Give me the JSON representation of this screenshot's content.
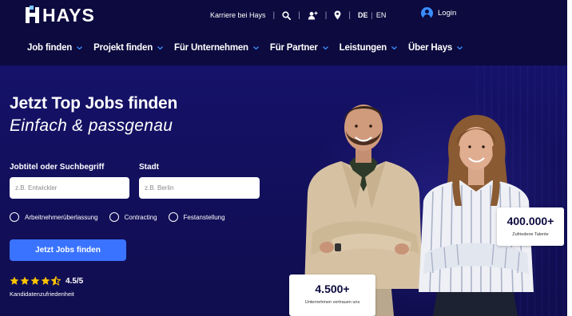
{
  "brand": {
    "logo_text": "HAYS"
  },
  "topbar": {
    "career_link": "Karriere bei Hays",
    "lang_de": "DE",
    "lang_en": "EN",
    "login_label": "Login",
    "icons": [
      "search-icon",
      "person-add-icon",
      "location-pin-icon",
      "user-icon"
    ]
  },
  "nav": {
    "items": [
      {
        "label": "Job finden"
      },
      {
        "label": "Projekt finden"
      },
      {
        "label": "Für Unternehmen"
      },
      {
        "label": "Für Partner"
      },
      {
        "label": "Leistungen"
      },
      {
        "label": "Über Hays"
      }
    ]
  },
  "hero": {
    "title": "Jetzt Top Jobs finden",
    "subtitle": "Einfach & passgenau",
    "job_label": "Jobtitel oder Suchbegriff",
    "job_placeholder": "z.B. Entwickler",
    "city_label": "Stadt",
    "city_placeholder": "z.B. Berlin",
    "radios": [
      {
        "label": "Arbeitnehmerüberlassung",
        "selected": false
      },
      {
        "label": "Contracting",
        "selected": false
      },
      {
        "label": "Festanstellung",
        "selected": false
      }
    ],
    "cta_label": "Jetzt Jobs finden",
    "rating": {
      "value": "4.5/5",
      "stars": 4.5,
      "caption": "Kandidatenzufriedenheit"
    }
  },
  "stats": {
    "companies": {
      "number": "4.500+",
      "caption": "Unternehmen vertrauen uns"
    },
    "talents": {
      "number": "400.000+",
      "caption": "Zufriedene Talente"
    }
  },
  "colors": {
    "header_bg": "#0c0a3e",
    "hero_bg": "#14116a",
    "accent": "#3a73ff",
    "star": "#ffc400"
  }
}
